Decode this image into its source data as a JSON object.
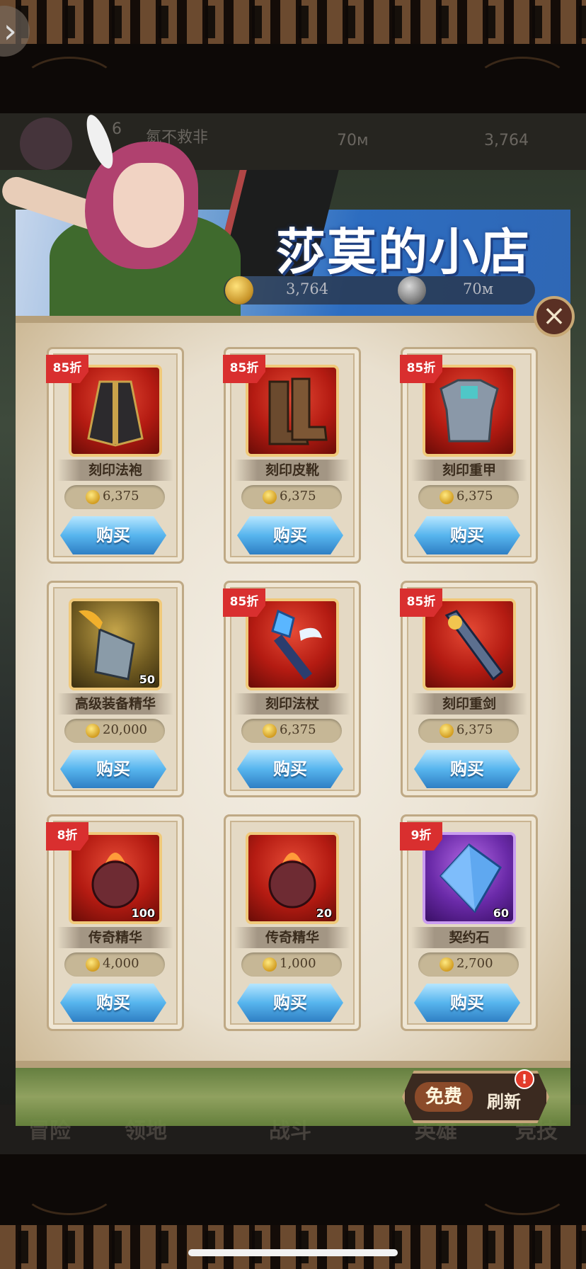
{
  "background": {
    "player_name": "氮不救非",
    "player_level": "6",
    "silver": "70м",
    "gold": "3,764",
    "tabs": [
      "冒险",
      "领地",
      "战斗",
      "英雄",
      "竞技"
    ]
  },
  "shop": {
    "title": "莎莫的小店",
    "gold_amount": "3,764",
    "silver_amount": "70м",
    "close_icon": "close-icon",
    "buy_label": "购买",
    "items": [
      {
        "name": "刻印法袍",
        "price": "6,375",
        "discount": "85折",
        "qty": "",
        "frame": "red",
        "icon": "robe-icon"
      },
      {
        "name": "刻印皮靴",
        "price": "6,375",
        "discount": "85折",
        "qty": "",
        "frame": "red",
        "icon": "boots-icon"
      },
      {
        "name": "刻印重甲",
        "price": "6,375",
        "discount": "85折",
        "qty": "",
        "frame": "red",
        "icon": "armor-icon"
      },
      {
        "name": "高级装备精华",
        "price": "20,000",
        "discount": "",
        "qty": "50",
        "frame": "gold",
        "icon": "essence-bottle-icon"
      },
      {
        "name": "刻印法杖",
        "price": "6,375",
        "discount": "85折",
        "qty": "",
        "frame": "red",
        "icon": "staff-icon"
      },
      {
        "name": "刻印重剑",
        "price": "6,375",
        "discount": "85折",
        "qty": "",
        "frame": "red",
        "icon": "greatsword-icon"
      },
      {
        "name": "传奇精华",
        "price": "4,000",
        "discount": "8折",
        "qty": "100",
        "frame": "red",
        "icon": "legend-essence-icon"
      },
      {
        "name": "传奇精华",
        "price": "1,000",
        "discount": "",
        "qty": "20",
        "frame": "red",
        "icon": "legend-essence-icon"
      },
      {
        "name": "契约石",
        "price": "2,700",
        "discount": "9折",
        "qty": "60",
        "frame": "purple",
        "icon": "contract-stone-icon"
      }
    ],
    "refresh": {
      "free_label": "免费",
      "label": "刷新",
      "alert": "!"
    }
  },
  "colors": {
    "accent_blue": "#4fb0ea",
    "discount_red": "#d92f2f",
    "panel_bg": "#efe7d7"
  }
}
